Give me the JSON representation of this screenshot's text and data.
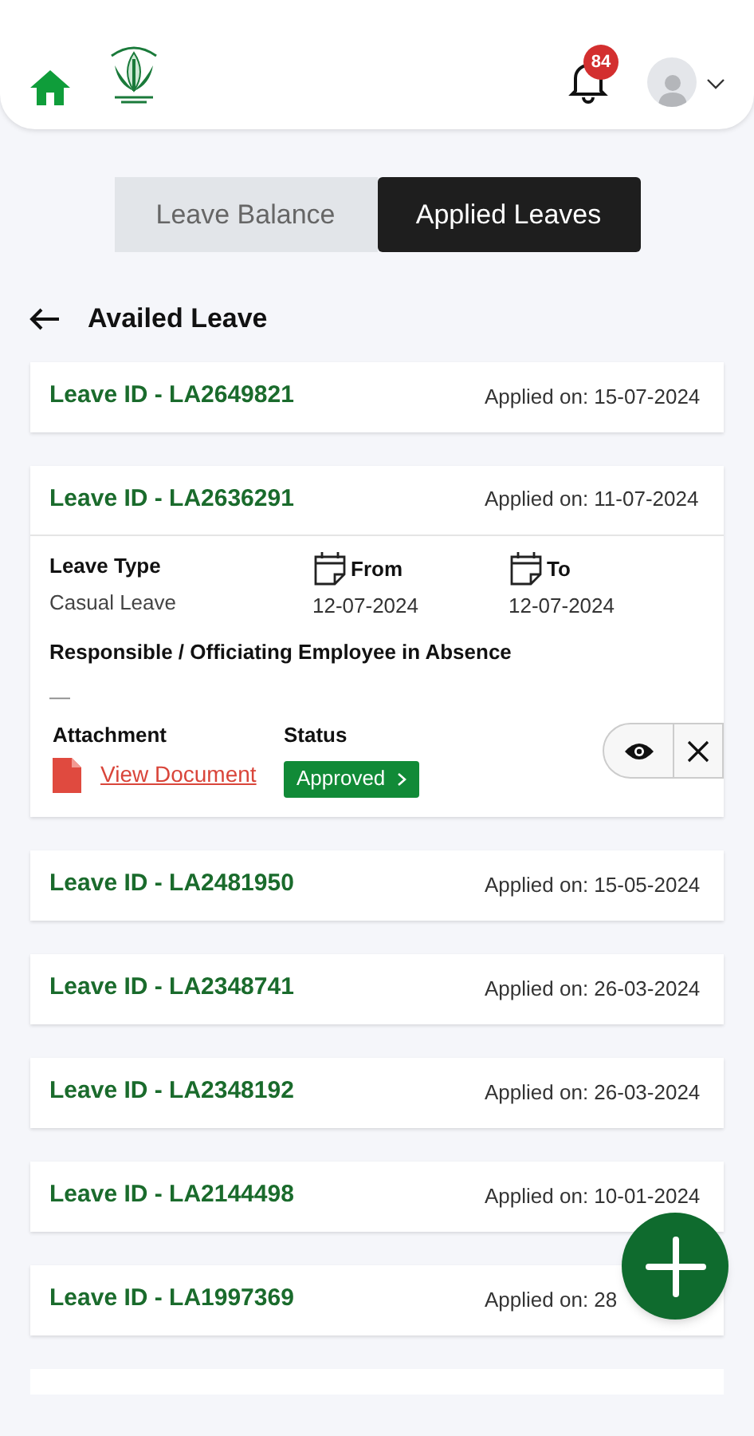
{
  "header": {
    "notification_count": "84"
  },
  "tabs": [
    {
      "label": "Leave Balance",
      "selected": false
    },
    {
      "label": "Applied Leaves",
      "selected": true
    }
  ],
  "section_title": "Availed Leave",
  "leaves": [
    {
      "id": "Leave ID - LA2649821",
      "applied": "Applied on: 15-07-2024",
      "expanded": false
    },
    {
      "id": "Leave ID - LA2636291",
      "applied": "Applied on: 11-07-2024",
      "expanded": true,
      "details": {
        "leave_type_label": "Leave Type",
        "leave_type": "Casual Leave",
        "from_label": "From",
        "from": "12-07-2024",
        "to_label": "To",
        "to": "12-07-2024",
        "responsible_label": "Responsible / Officiating Employee in Absence",
        "responsible": "—",
        "attachment_label": "Attachment",
        "attachment_link": "View Document",
        "status_label": "Status",
        "status": "Approved"
      }
    },
    {
      "id": "Leave ID - LA2481950",
      "applied": "Applied on: 15-05-2024",
      "expanded": false
    },
    {
      "id": "Leave ID - LA2348741",
      "applied": "Applied on: 26-03-2024",
      "expanded": false
    },
    {
      "id": "Leave ID - LA2348192",
      "applied": "Applied on: 26-03-2024",
      "expanded": false
    },
    {
      "id": "Leave ID - LA2144498",
      "applied": "Applied on: 10-01-2024",
      "expanded": false
    },
    {
      "id": "Leave ID - LA1997369",
      "applied": "Applied on: 28",
      "expanded": false
    }
  ]
}
